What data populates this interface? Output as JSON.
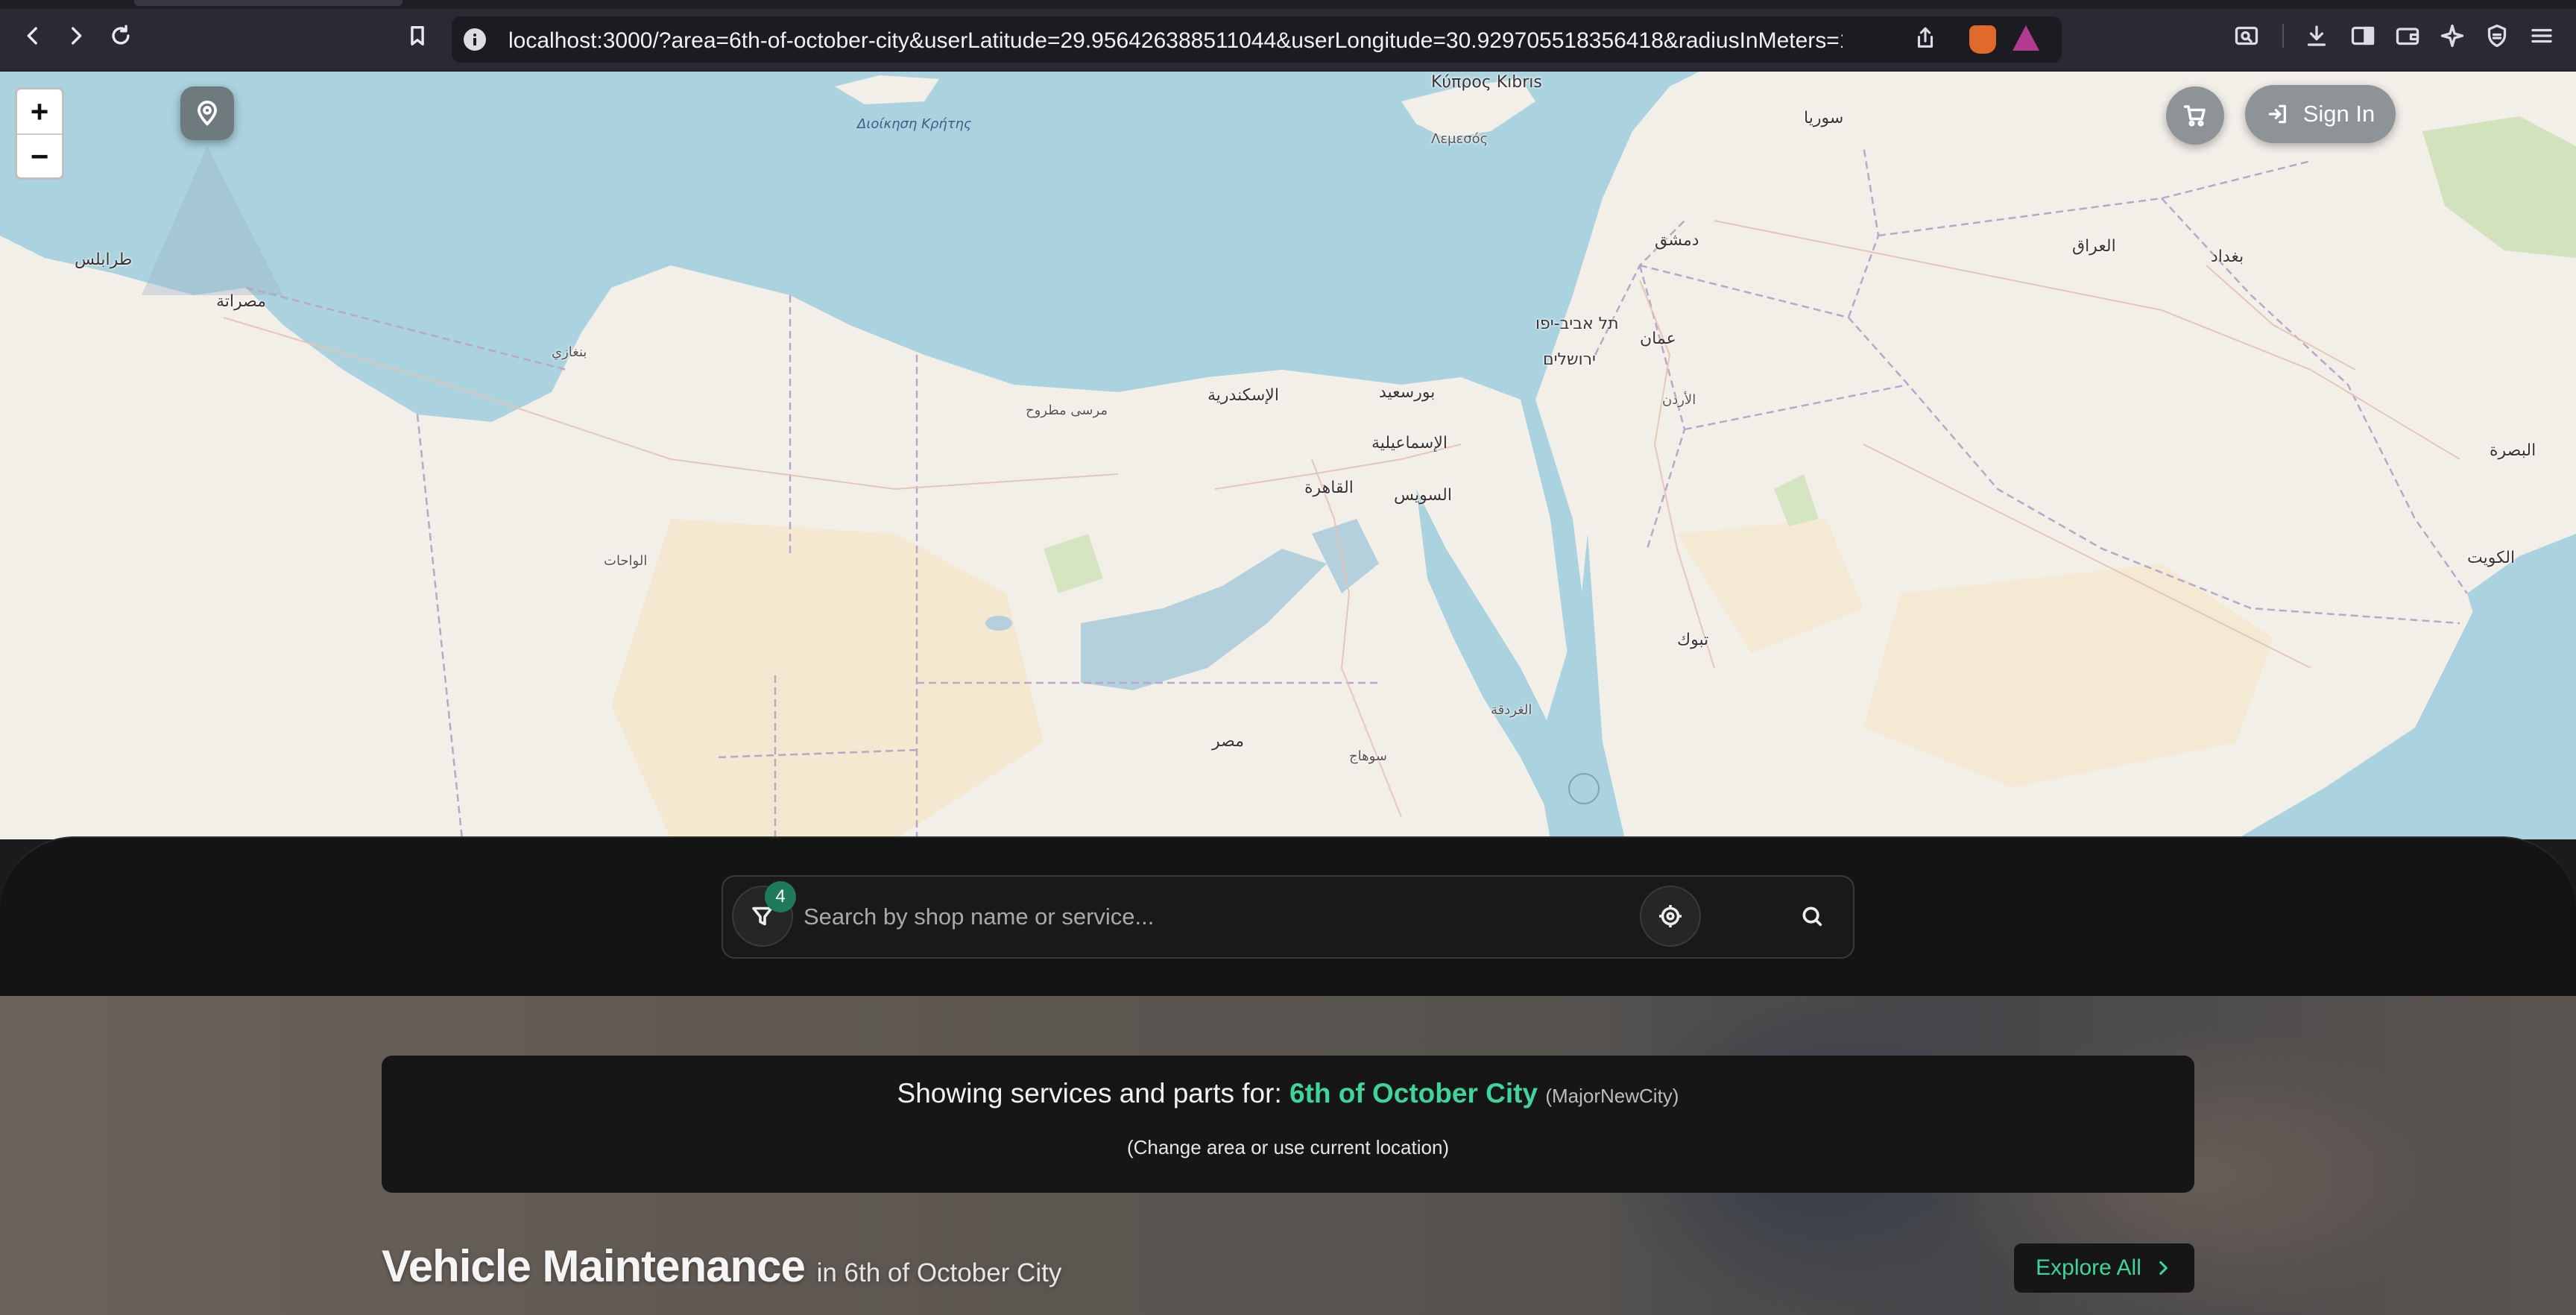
{
  "browser": {
    "url": "localhost:3000/?area=6th-of-october-city&userLatitude=29.956426388511044&userLongitude=30.929705518356418&radiusInMeters=1..."
  },
  "map": {
    "zoom_in": "+",
    "zoom_out": "−",
    "labels": {
      "cyprus": "Κύπρος Kıbrıs",
      "lemesos": "Λεμεσός",
      "crete": "Διοίκηση Κρήτης",
      "syria": "سوريا",
      "tripoli": "طرابلس",
      "misrata": "مصراتة",
      "alexandria": "الإسكندرية",
      "portsaid": "بورسعيد",
      "cairo": "القاهرة",
      "ismailia": "الإسماعيلية",
      "suez": "السويس",
      "damascus": "دمشق",
      "amman": "عمان",
      "telaviv": "תל אביב-יפו",
      "jerusalem": "ירושלים",
      "baghdad": "بغداد",
      "iraq": "العراق",
      "basra": "البصرة",
      "kuwait": "الكويت",
      "tabuk": "تبوك",
      "egypt": "مصر",
      "benghazi": "بنغازي",
      "marsamatruh": "مرسى مطروح",
      "hurghada": "الغردقة",
      "jordan": "الأردن",
      "alwahat": "الواحات",
      "sohag": "سوهاج"
    }
  },
  "header": {
    "sign_in_label": "Sign In"
  },
  "search": {
    "placeholder": "Search by shop name or service...",
    "filter_count": "4"
  },
  "area_banner": {
    "prefix": "Showing services and parts for:",
    "city": "6th of October City",
    "city_type": "(MajorNewCity)",
    "change_hint": "(Change area or use current location)"
  },
  "section": {
    "title": "Vehicle Maintenance",
    "subtitle": "in 6th of October City",
    "explore_label": "Explore All"
  },
  "colors": {
    "accent": "#3fd49a",
    "badge": "#1f7a5c",
    "sea": "#aad3df",
    "land": "#f2efe9"
  }
}
